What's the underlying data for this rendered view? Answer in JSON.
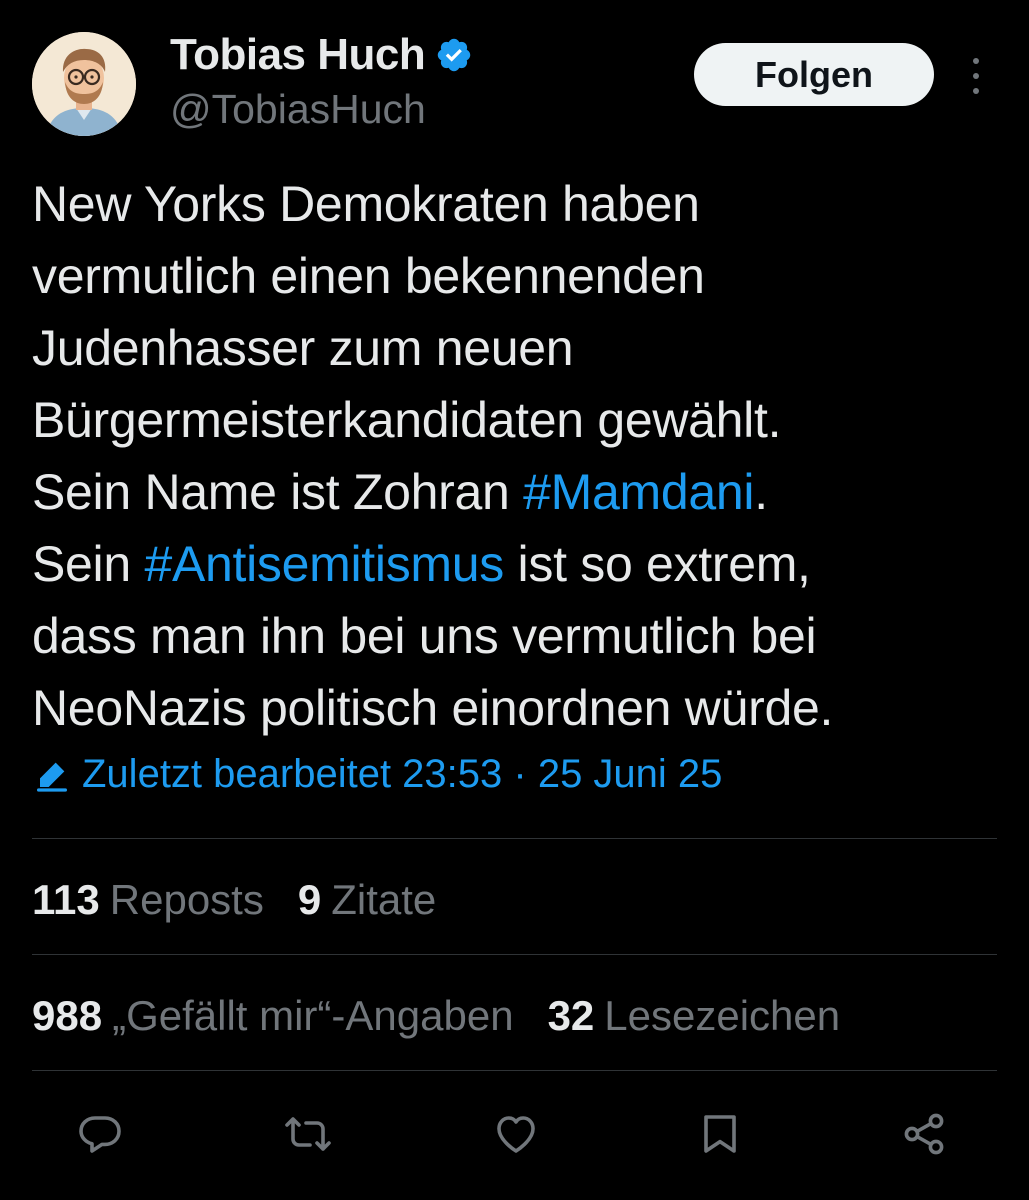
{
  "author": {
    "display_name": "Tobias Huch",
    "handle": "@TobiasHuch",
    "verified": true,
    "avatar_icon": "profile-avatar"
  },
  "header": {
    "follow_label": "Folgen",
    "more_icon": "more-vertical-icon"
  },
  "tweet": {
    "lines": [
      [
        {
          "text": "New Yorks Demokraten haben",
          "hashtag": false
        }
      ],
      [
        {
          "text": "vermutlich einen bekennenden",
          "hashtag": false
        }
      ],
      [
        {
          "text": "Judenhasser zum neuen",
          "hashtag": false
        }
      ],
      [
        {
          "text": "Bürgermeisterkandidaten gewählt.",
          "hashtag": false
        }
      ],
      [
        {
          "text": "Sein Name ist Zohran ",
          "hashtag": false
        },
        {
          "text": "#Mamdani",
          "hashtag": true
        },
        {
          "text": ".",
          "hashtag": false
        }
      ],
      [
        {
          "text": "Sein ",
          "hashtag": false
        },
        {
          "text": "#Antisemitismus",
          "hashtag": true
        },
        {
          "text": " ist so extrem,",
          "hashtag": false
        }
      ],
      [
        {
          "text": "dass man ihn bei uns vermutlich bei",
          "hashtag": false
        }
      ],
      [
        {
          "text": "NeoNazis politisch einordnen würde.",
          "hashtag": false
        }
      ]
    ],
    "edited_label": "Zuletzt bearbeitet 23:53 · 25 Juni 25"
  },
  "stats": {
    "reposts": {
      "num": "113",
      "label": "Reposts"
    },
    "quotes": {
      "num": "9",
      "label": "Zitate"
    },
    "likes": {
      "num": "988",
      "label": "„Gefällt mir“-Angaben"
    },
    "bookmarks": {
      "num": "32",
      "label": "Lesezeichen"
    }
  },
  "actions": [
    {
      "name": "reply",
      "icon": "reply-icon"
    },
    {
      "name": "repost",
      "icon": "repost-icon"
    },
    {
      "name": "like",
      "icon": "heart-icon"
    },
    {
      "name": "bookmark",
      "icon": "bookmark-icon"
    },
    {
      "name": "share",
      "icon": "share-icon"
    }
  ],
  "colors": {
    "background": "#000000",
    "text": "#e7e9ea",
    "secondary": "#71767b",
    "accent": "#1d9bf0",
    "divider": "#2f3336",
    "button_bg": "#eff3f4"
  }
}
